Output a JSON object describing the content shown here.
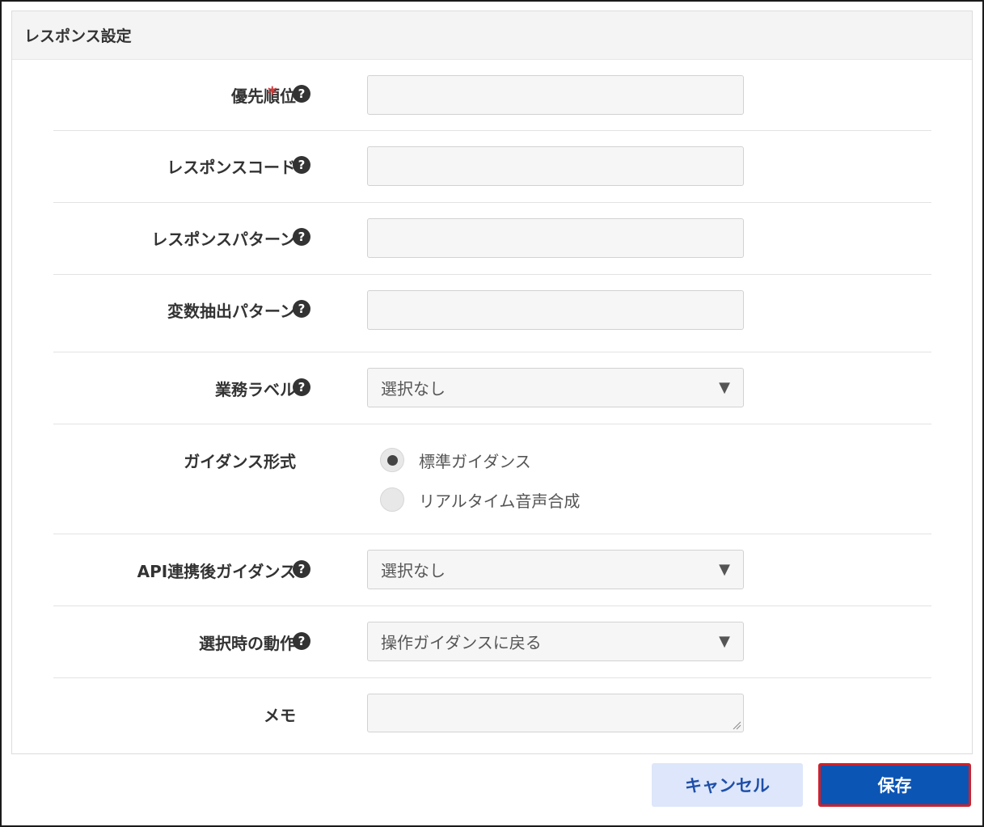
{
  "panel": {
    "title": "レスポンス設定"
  },
  "fields": {
    "priority": {
      "label": "優先順位",
      "required_mark": "*",
      "value": ""
    },
    "response_code": {
      "label": "レスポンスコード",
      "value": ""
    },
    "response_pattern": {
      "label": "レスポンスパターン",
      "value": ""
    },
    "variable_pattern": {
      "label": "変数抽出パターン",
      "value": ""
    },
    "business_label": {
      "label": "業務ラベル",
      "selected": "選択なし"
    },
    "guidance_format": {
      "label": "ガイダンス形式",
      "options": [
        {
          "label": "標準ガイダンス",
          "checked": true
        },
        {
          "label": "リアルタイム音声合成",
          "checked": false
        }
      ]
    },
    "api_guidance": {
      "label": "API連携後ガイダンス",
      "selected": "選択なし"
    },
    "select_action": {
      "label": "選択時の動作",
      "selected": "操作ガイダンスに戻る"
    },
    "memo": {
      "label": "メモ",
      "value": ""
    }
  },
  "icons": {
    "help": "question-circle-icon",
    "caret": "triangle-down-icon"
  },
  "help_glyph": "?",
  "caret_glyph": "▼",
  "buttons": {
    "cancel": "キャンセル",
    "save": "保存"
  },
  "colors": {
    "save_bg": "#0b55b5",
    "save_highlight_border": "#d0202a",
    "cancel_bg": "#dde6fa",
    "required": "#d23a3a"
  }
}
